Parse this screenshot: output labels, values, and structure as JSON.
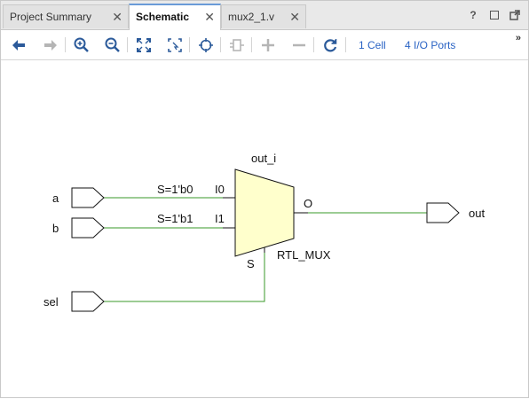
{
  "tabs": [
    {
      "label": "Project Summary",
      "active": false
    },
    {
      "label": "Schematic",
      "active": true
    },
    {
      "label": "mux2_1.v",
      "active": false
    }
  ],
  "tab_close_glyph": "✕",
  "window_icons": [
    "help-icon",
    "maximize-icon",
    "float-icon"
  ],
  "window_help_glyph": "?",
  "toolbar": {
    "cells_label": "1 Cell",
    "ports_label": "4 I/O Ports",
    "overflow_glyph": "»"
  },
  "schematic": {
    "instance_name": "out_i",
    "cell_type": "RTL_MUX",
    "pins": {
      "i0": "I0",
      "i1": "I1",
      "o": "O",
      "s": "S"
    },
    "input_ports": [
      "a",
      "b",
      "sel"
    ],
    "output_ports": [
      "out"
    ],
    "net_labels": {
      "a": "S=1'b0",
      "b": "S=1'b1"
    },
    "colors": {
      "wire": "#3a9a2a",
      "mux_fill": "#ffffcc",
      "accent": "#6a9bd8",
      "link": "#2a63c4"
    }
  }
}
